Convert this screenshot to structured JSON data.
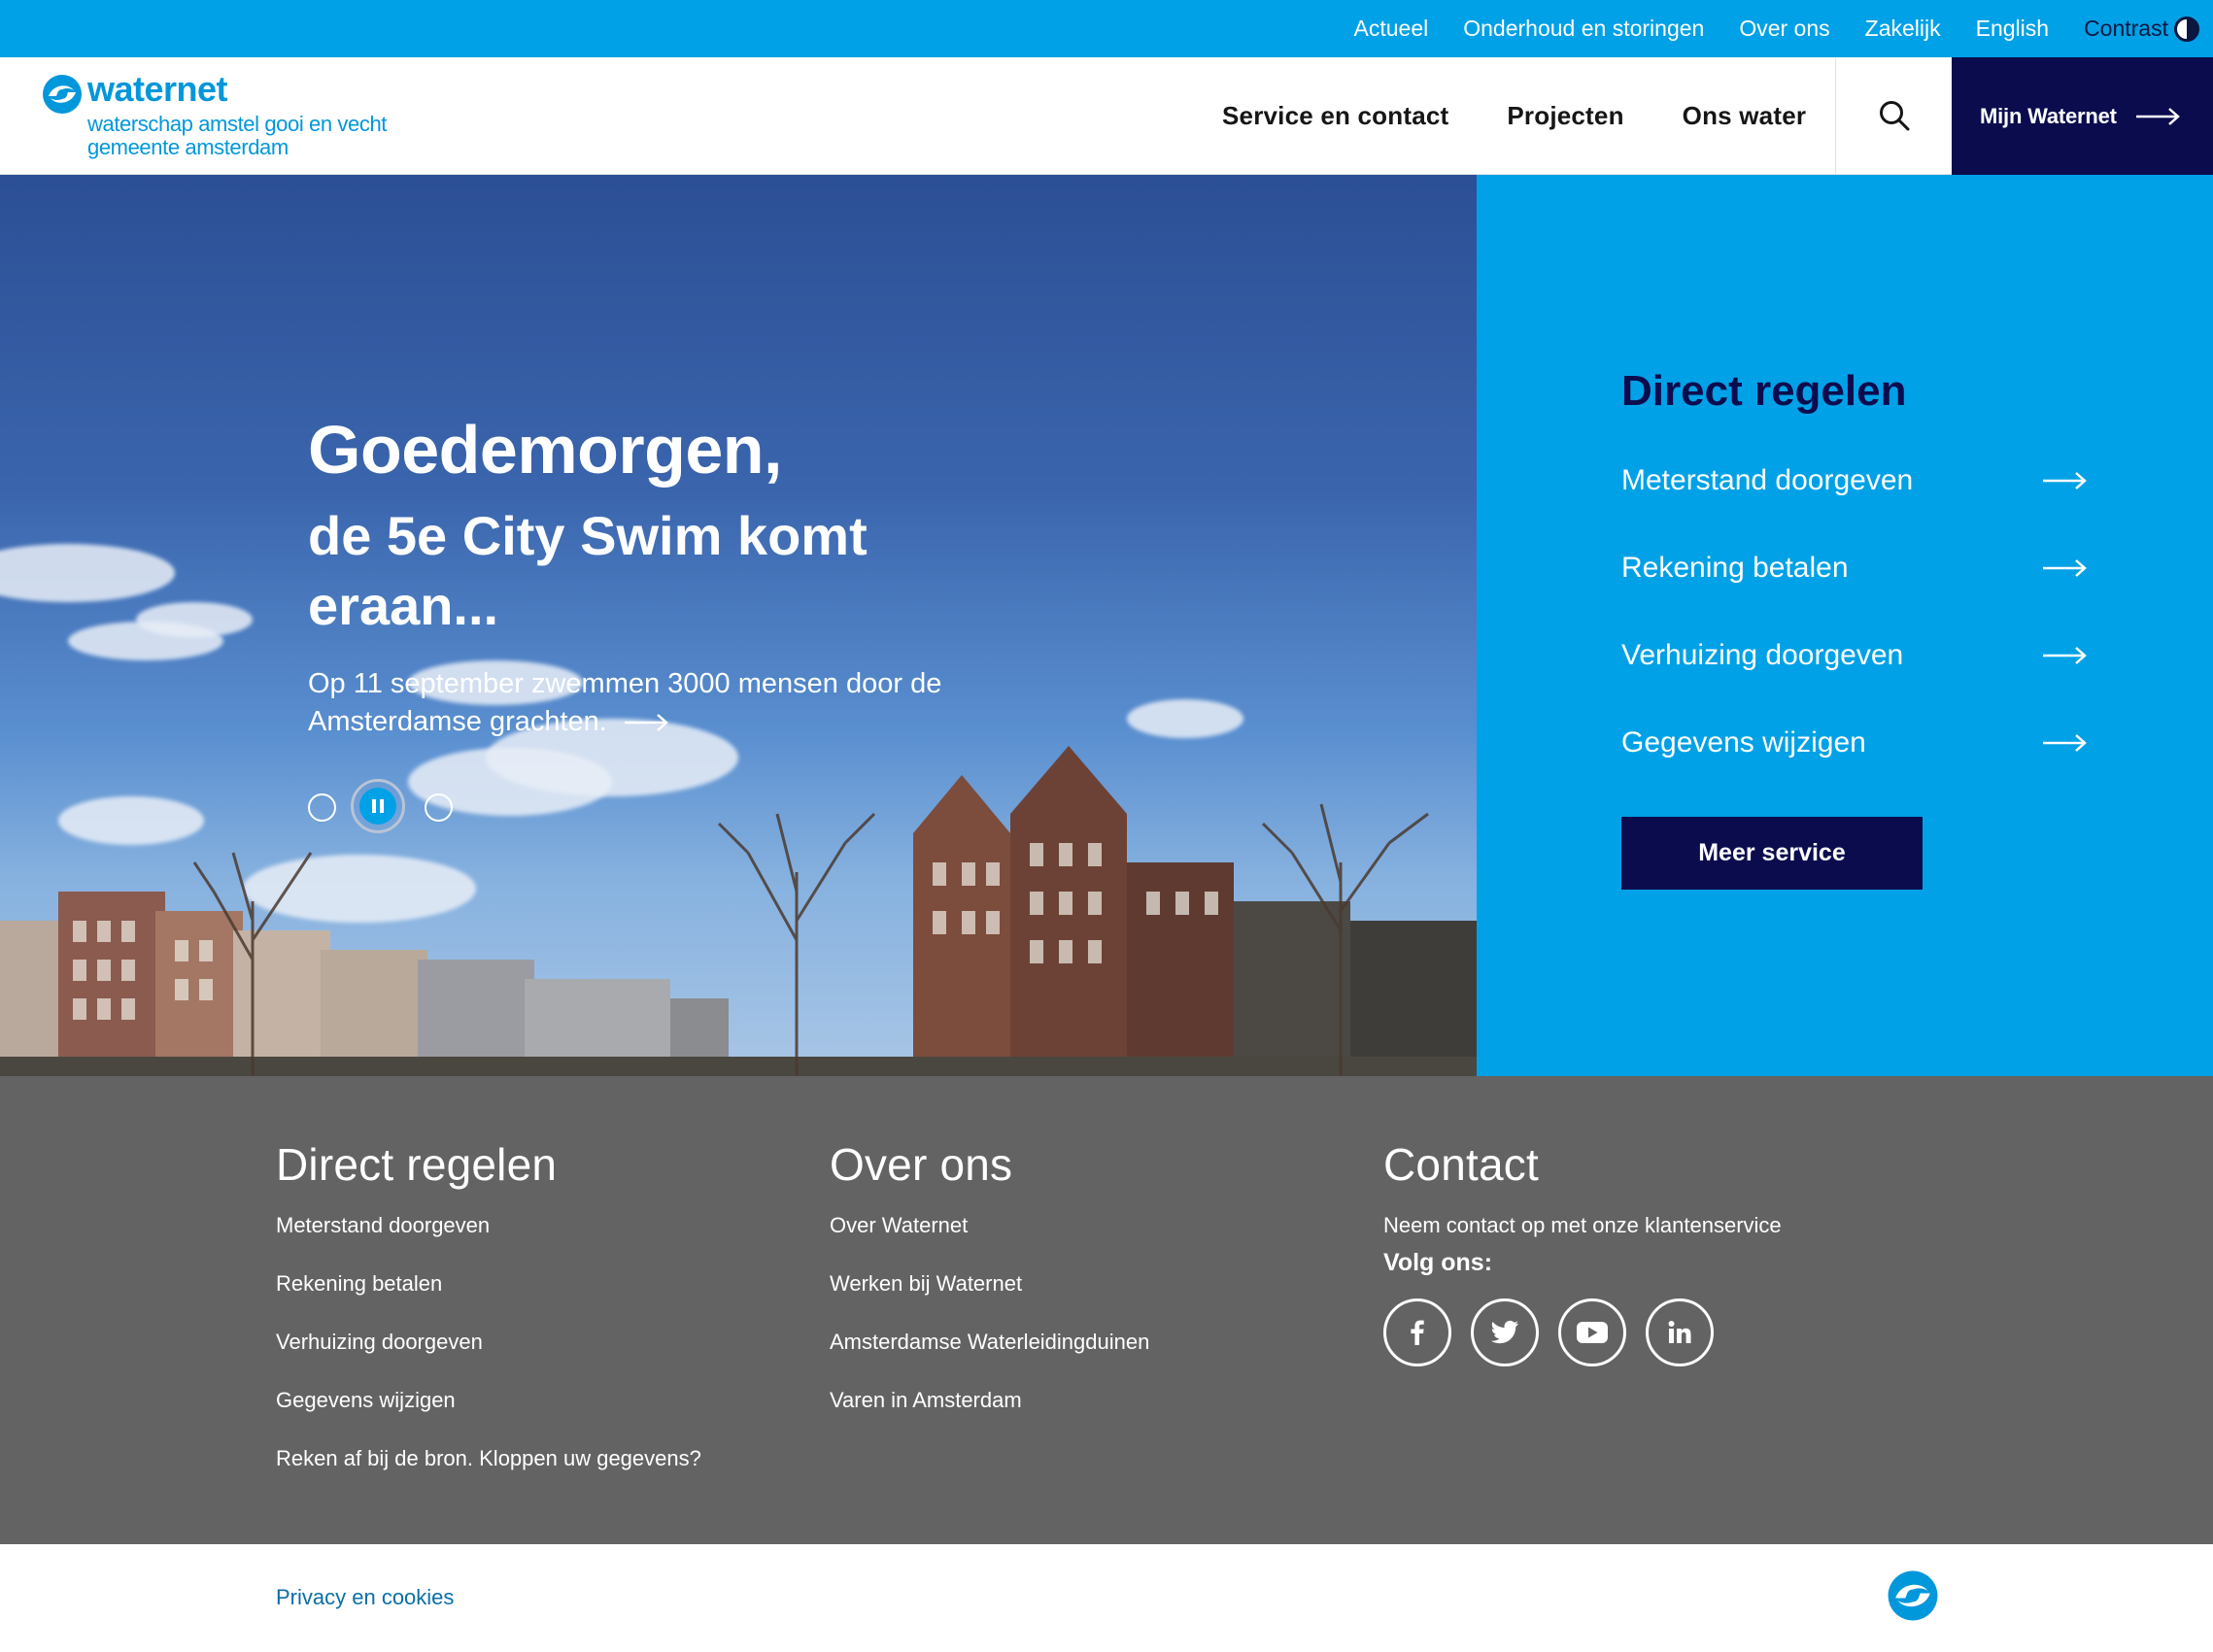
{
  "colors": {
    "accent": "#00a1e6",
    "navy": "#0b0c4e",
    "footer_bg": "#636363"
  },
  "topbar": {
    "links": [
      "Actueel",
      "Onderhoud en storingen",
      "Over ons",
      "Zakelijk",
      "English"
    ],
    "contrast_label": "Contrast",
    "contrast_icon": "contrast-icon"
  },
  "header": {
    "logo": {
      "word": "waternet",
      "line1": "waterschap amstel gooi en vecht",
      "line2": "gemeente amsterdam"
    },
    "nav": [
      "Service en contact",
      "Projecten",
      "Ons water"
    ],
    "search_icon": "search-icon",
    "mijn_label": "Mijn Waternet"
  },
  "hero": {
    "greeting": "Goedemorgen,",
    "headline": "de 5e City Swim komt eraan...",
    "text": "Op 11 september zwemmen 3000 mensen door de Amsterdamse grachten.",
    "slides": 3,
    "active_slide": 2
  },
  "panel": {
    "title": "Direct regelen",
    "links": [
      "Meterstand doorgeven",
      "Rekening betalen",
      "Verhuizing doorgeven",
      "Gegevens wijzigen"
    ],
    "button": "Meer service"
  },
  "footer": {
    "col1": {
      "title": "Direct regelen",
      "links": [
        "Meterstand doorgeven",
        "Rekening betalen",
        "Verhuizing doorgeven",
        "Gegevens wijzigen",
        "Reken af bij de bron. Kloppen uw gegevens?"
      ]
    },
    "col2": {
      "title": "Over ons",
      "links": [
        "Over Waternet",
        "Werken bij Waternet",
        "Amsterdamse Waterleidingduinen",
        "Varen in Amsterdam"
      ]
    },
    "col3": {
      "title": "Contact",
      "contact_text": "Neem contact op met onze klantenservice",
      "follow_label": "Volg ons:",
      "socials": [
        "facebook-icon",
        "twitter-icon",
        "youtube-icon",
        "linkedin-icon"
      ]
    }
  },
  "bottom": {
    "privacy": "Privacy en cookies"
  }
}
